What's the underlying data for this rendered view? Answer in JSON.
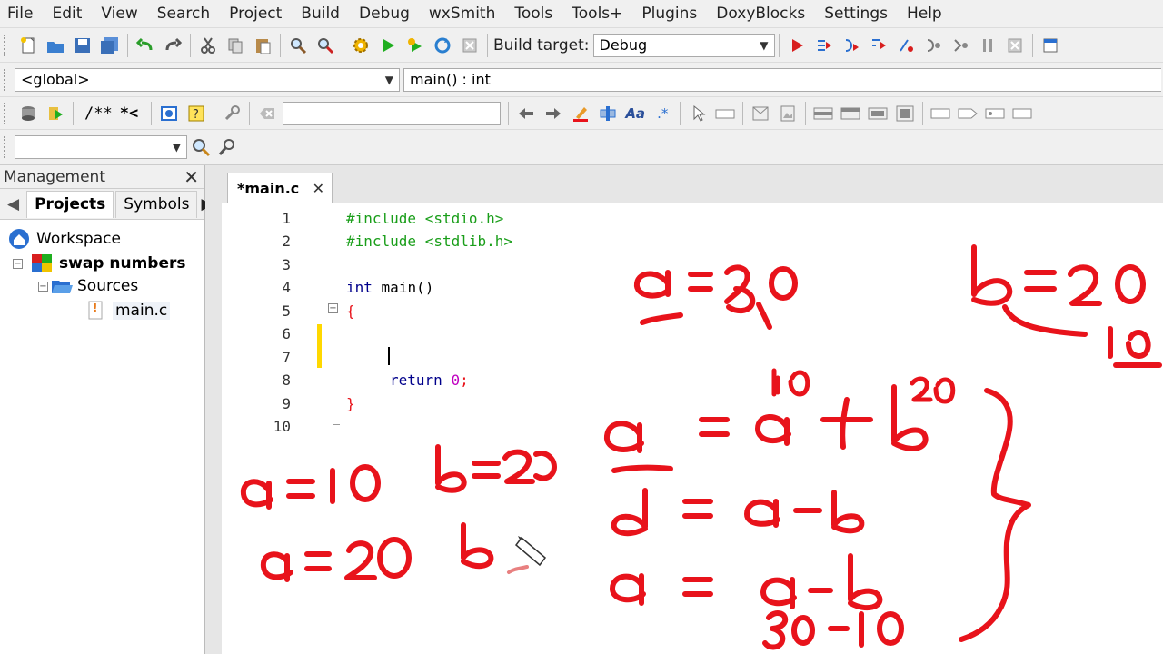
{
  "menu": [
    "File",
    "Edit",
    "View",
    "Search",
    "Project",
    "Build",
    "Debug",
    "wxSmith",
    "Tools",
    "Tools+",
    "Plugins",
    "DoxyBlocks",
    "Settings",
    "Help"
  ],
  "toolbar": {
    "build_target_label": "Build target:",
    "build_target_value": "Debug",
    "scope_value": "<global>",
    "function_value": "main() : int",
    "doxy_comment": "/**",
    "doxy_line": "*<"
  },
  "management": {
    "title": "Management",
    "tabs": [
      "Projects",
      "Symbols"
    ],
    "tree": {
      "workspace": "Workspace",
      "project": "swap numbers",
      "folder": "Sources",
      "file": "main.c"
    }
  },
  "editor": {
    "tab_label": "*main.c",
    "line_numbers": [
      "1",
      "2",
      "3",
      "4",
      "5",
      "6",
      "7",
      "8",
      "9",
      "10"
    ],
    "lines": {
      "l1": "#include <stdio.h>",
      "l2": "#include <stdlib.h>",
      "l4_kw": "int",
      "l4_rest": " main()",
      "l5": "{",
      "l8_kw": "return",
      "l8_num": "0",
      "l8_semi": ";",
      "l9": "}"
    }
  },
  "colors": {
    "preprocessor": "#1a9e1a",
    "keyword": "#00008b",
    "number": "#c000c0",
    "brace": "#e8131b",
    "ink": "#e8131b",
    "change_marker": "#ffd800"
  }
}
